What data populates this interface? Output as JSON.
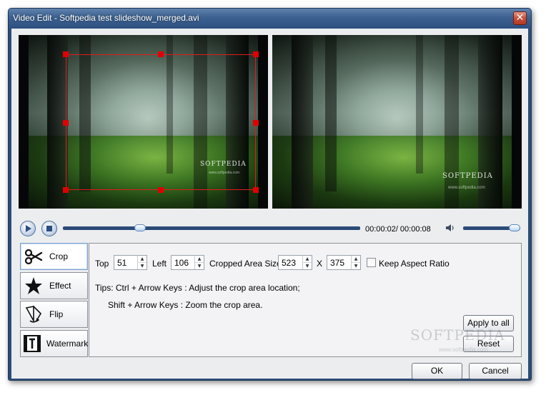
{
  "window": {
    "title": "Video Edit - Softpedia test slideshow_merged.avi",
    "close_glyph": "✕"
  },
  "preview": {
    "left_logo": "SOFTPEDIA",
    "left_logo_sub": "www.softpedia.com",
    "right_logo": "SOFTPEDIA",
    "right_logo_sub": "www.softpedia.com"
  },
  "playback": {
    "time": "00:00:02/ 00:00:08",
    "seek_fraction": 0.25,
    "volume_fraction": 1.0,
    "play_icon": "play-icon",
    "stop_icon": "stop-icon",
    "speaker_icon": "speaker-icon"
  },
  "tabs": [
    {
      "label": "Crop",
      "icon": "scissors-icon",
      "active": true
    },
    {
      "label": "Effect",
      "icon": "star-icon",
      "active": false
    },
    {
      "label": "Flip",
      "icon": "flip-icon",
      "active": false
    },
    {
      "label": "Watermark",
      "icon": "text-watermark-icon",
      "active": false
    }
  ],
  "crop": {
    "top_label": "Top",
    "top_value": "51",
    "left_label": "Left",
    "left_value": "106",
    "area_label": "Cropped Area Size",
    "width_value": "523",
    "x_label": "X",
    "height_value": "375",
    "keep_ratio_label": "Keep Aspect Ratio",
    "keep_ratio_checked": false,
    "tip_line1": "Tips: Ctrl  + Arrow Keys : Adjust the crop area location;",
    "tip_line2": "Shift + Arrow Keys : Zoom the crop area.",
    "apply_all_label": "Apply to all",
    "reset_label": "Reset"
  },
  "footer": {
    "ok_label": "OK",
    "cancel_label": "Cancel"
  },
  "watermark": {
    "text": "SOFTPEDIA",
    "sub": "www.softpedia.com"
  },
  "colors": {
    "titlebar": "#3c6190",
    "crop_frame": "#e11b1b",
    "slider_track": "#2c4a78"
  }
}
